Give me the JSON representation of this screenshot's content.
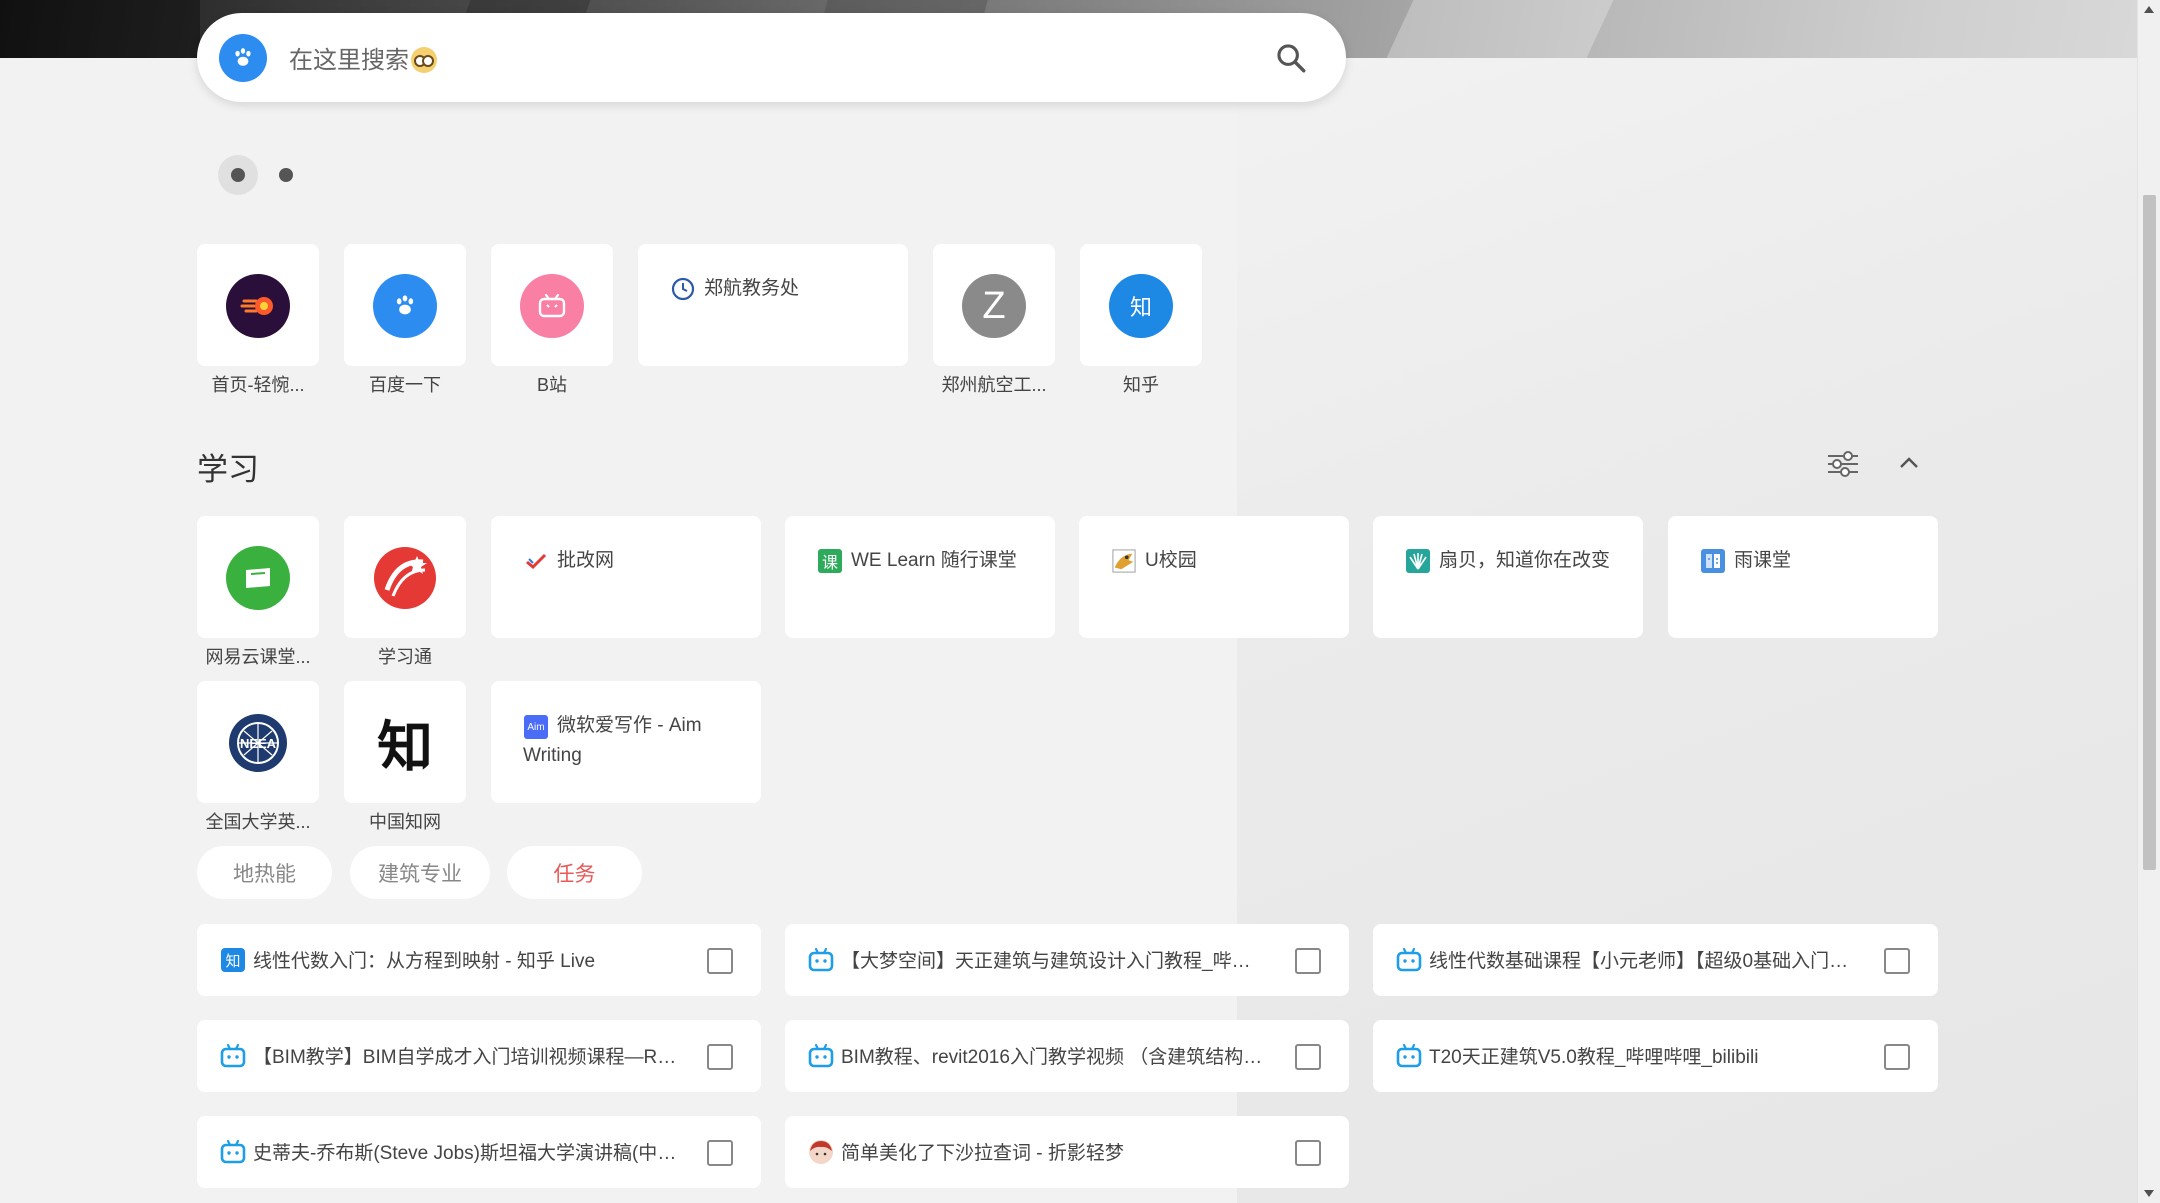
{
  "search": {
    "placeholder": "在这里搜索"
  },
  "pages": {
    "count": 2,
    "active": 0
  },
  "shortcuts": [
    {
      "label": "首页-轻惋...",
      "icon": "rocket-icon",
      "color": "#2a0f3a"
    },
    {
      "label": "百度一下",
      "icon": "baidu-paw-icon",
      "color": "#2c8cf0"
    },
    {
      "label": "B站",
      "icon": "bilibili-tv-icon",
      "color": "#f97fa4"
    },
    {
      "label": "郑航教务处",
      "icon": "clock-icon"
    },
    {
      "label": "郑州航空工...",
      "icon": "letter-z-icon",
      "color": "#8a8a8a",
      "letter": "Z"
    },
    {
      "label": "知乎",
      "icon": "zhihu-icon",
      "color": "#1e88e5",
      "letter": "知"
    }
  ],
  "section": {
    "title": "学习"
  },
  "study": [
    {
      "label": "网易云课堂...",
      "icon": "netease-study-icon",
      "color": "#3ab03e"
    },
    {
      "label": "学习通",
      "icon": "xuexitong-icon",
      "color": "#e53935"
    },
    {
      "label": "批改网",
      "icon": "pigai-check-icon"
    },
    {
      "label": "WE Learn 随行课堂",
      "icon": "welearn-icon",
      "color": "#2eaa5b",
      "glyph": "课"
    },
    {
      "label": "U校园",
      "icon": "uxiaoyuan-icon"
    },
    {
      "label": "扇贝，知道你在改变",
      "icon": "shanbay-icon",
      "color": "#26a69a"
    },
    {
      "label": "雨课堂",
      "icon": "yuketang-icon",
      "color": "#4a90e2"
    },
    {
      "label": "全国大学英...",
      "icon": "neea-icon",
      "color": "#1e3a6e"
    },
    {
      "label": "中国知网",
      "icon": "cnki-icon",
      "glyph": "知"
    },
    {
      "label": "微软爱写作 - Aim Writing",
      "icon": "aim-writing-icon",
      "color": "#4a6cf7",
      "glyph": "Aim"
    }
  ],
  "tags": [
    {
      "label": "地热能"
    },
    {
      "label": "建筑专业"
    },
    {
      "label": "任务"
    }
  ],
  "tasks": [
    {
      "text": "线性代数入门：从方程到映射 - 知乎 Live",
      "icon": "zhihu-icon"
    },
    {
      "text": "【大梦空间】天正建筑与建筑设计入门教程_哔哩哔...",
      "icon": "bilibili-tv-icon"
    },
    {
      "text": "线性代数基础课程【小元老师】【超级0基础入门】...",
      "icon": "bilibili-tv-icon"
    },
    {
      "text": "【BIM教学】BIM自学成才入门培训视频课程—Revi...",
      "icon": "bilibili-tv-icon"
    },
    {
      "text": "BIM教程、revit2016入门教学视频 （含建筑结构、...",
      "icon": "bilibili-tv-icon"
    },
    {
      "text": "T20天正建筑V5.0教程_哔哩哔哩_bilibili",
      "icon": "bilibili-tv-icon"
    },
    {
      "text": "史蒂夫-乔布斯(Steve Jobs)斯坦福大学演讲稿(中英...",
      "icon": "bilibili-tv-icon"
    },
    {
      "text": "简单美化了下沙拉查词 - 折影轻梦",
      "icon": "avatar-icon"
    }
  ]
}
